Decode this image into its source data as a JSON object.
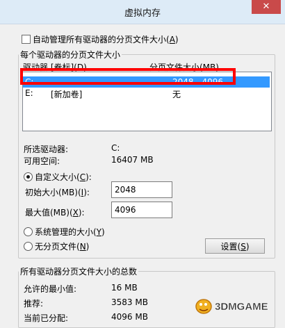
{
  "window": {
    "title": "虚拟内存",
    "close_symbol": "✕"
  },
  "auto_manage": {
    "label": "自动管理所有驱动器的分页文件大小(",
    "key": "A",
    "suffix": ")",
    "checked": false
  },
  "per_drive_group": {
    "title": "每个驱动器的分页文件大小",
    "col_drive": "驱动器 [卷标](D)",
    "col_paging": "分页文件大小(MB)",
    "rows": [
      {
        "drive": "C:",
        "label": "",
        "size": "2048 - 4096",
        "selected": true
      },
      {
        "drive": "E:",
        "label": "[新加卷]",
        "size": "无",
        "selected": false
      }
    ]
  },
  "selected_drive": {
    "label": "所选驱动器:",
    "value": "C:",
    "space_label": "可用空间:",
    "space_value": "16407 MB"
  },
  "custom_size": {
    "label": "自定义大小(",
    "key": "C",
    "suffix": "):",
    "selected": true,
    "initial_label": "初始大小(MB)(",
    "initial_key": "I",
    "initial_suffix": "):",
    "initial_value": "2048",
    "max_label": "最大值(MB)(",
    "max_key": "X",
    "max_suffix": "):",
    "max_value": "4096"
  },
  "system_managed": {
    "label": "系统管理的大小(",
    "key": "Y",
    "suffix": ")"
  },
  "no_paging": {
    "label": "无分页文件(",
    "key": "N",
    "suffix": ")"
  },
  "set_button": {
    "label": "设置(",
    "key": "S",
    "suffix": ")"
  },
  "total_group": {
    "title": "所有驱动器分页文件大小的总数",
    "min_label": "允许的最小值:",
    "min_value": "16 MB",
    "rec_label": "推荐:",
    "rec_value": "3583 MB",
    "cur_label": "当前已分配:",
    "cur_value": "4096 MB"
  },
  "watermark": {
    "text": "3DMGAME"
  },
  "colors": {
    "selection": "#3399ff",
    "highlight_box": "#ff0000",
    "close": "#c94a4a"
  }
}
